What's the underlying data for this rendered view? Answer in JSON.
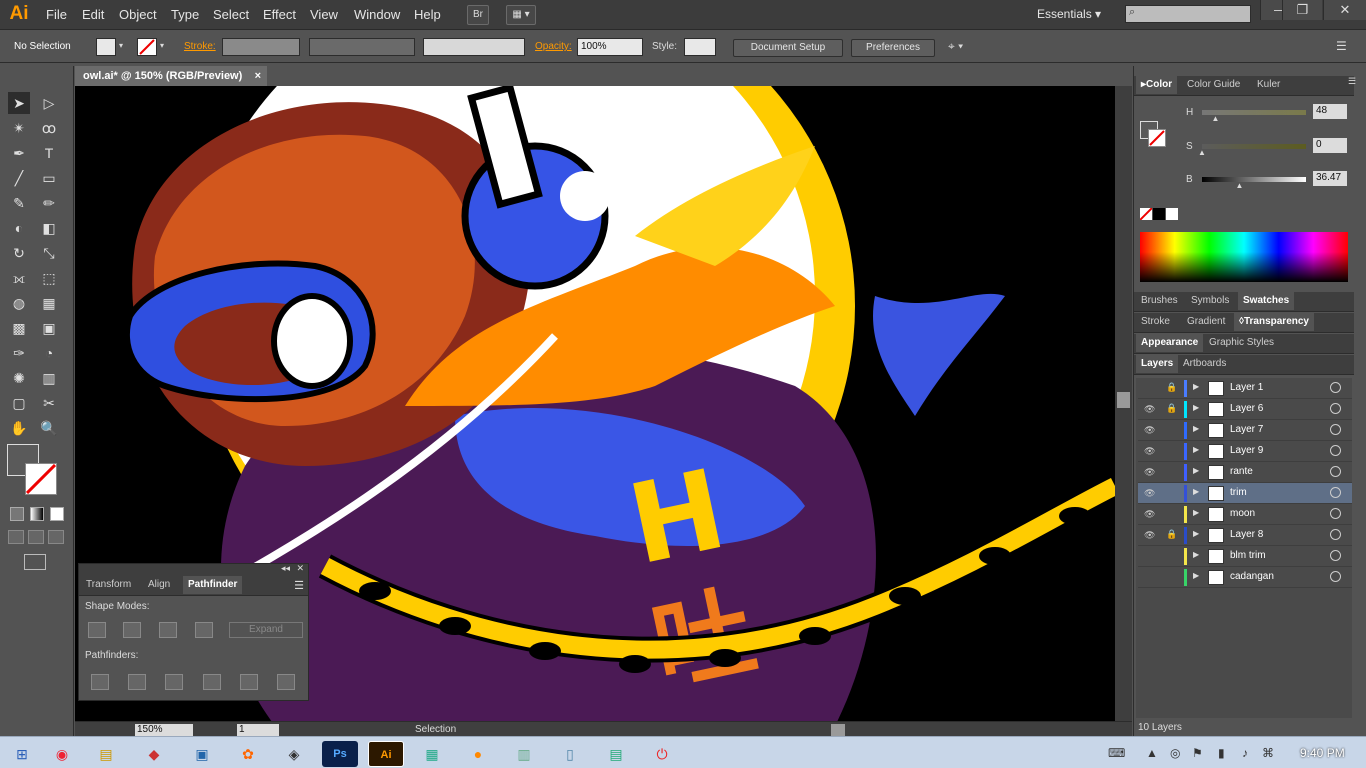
{
  "app": {
    "logo": "Ai",
    "workspace": "Essentials"
  },
  "menu": [
    "File",
    "Edit",
    "Object",
    "Type",
    "Select",
    "Effect",
    "View",
    "Window",
    "Help"
  ],
  "menu_buttons": {
    "bridge": "Br",
    "arrange": "▦"
  },
  "control": {
    "selection": "No Selection",
    "stroke_label": "Stroke:",
    "opacity_label": "Opacity:",
    "opacity_value": "100%",
    "style_label": "Style:",
    "document_setup": "Document Setup",
    "preferences": "Preferences"
  },
  "document": {
    "tab_title": "owl.ai* @ 150% (RGB/Preview)",
    "close": "×"
  },
  "status": {
    "zoom": "150%",
    "artboard": "1",
    "tool": "Selection"
  },
  "color_panel": {
    "tabs": [
      "Color",
      "Color Guide",
      "Kuler"
    ],
    "h_label": "H",
    "h_value": "48",
    "s_label": "S",
    "s_value": "0",
    "b_label": "B",
    "b_value": "36.47",
    "h_fill": 0.13,
    "s_fill": 0.0,
    "b_fill": 0.36
  },
  "panel_tabs": {
    "row1": [
      "Brushes",
      "Symbols",
      "Swatches"
    ],
    "row2": [
      "Stroke",
      "Gradient",
      "Transparency"
    ],
    "row3": [
      "Appearance",
      "Graphic Styles"
    ],
    "row4": [
      "Layers",
      "Artboards"
    ]
  },
  "layers": [
    {
      "name": "Layer 1",
      "eye": false,
      "lock": true,
      "color": "#4a7cff",
      "selected": false
    },
    {
      "name": "Layer 6",
      "eye": true,
      "lock": true,
      "color": "#00e5ff",
      "selected": false
    },
    {
      "name": "Layer 7",
      "eye": true,
      "lock": false,
      "color": "#2f6bff",
      "selected": false
    },
    {
      "name": "Layer 9",
      "eye": true,
      "lock": false,
      "color": "#3a66ff",
      "selected": false
    },
    {
      "name": "rante",
      "eye": true,
      "lock": false,
      "color": "#3f5fff",
      "selected": false
    },
    {
      "name": "trim",
      "eye": true,
      "lock": false,
      "color": "#3450d8",
      "selected": true
    },
    {
      "name": "moon",
      "eye": true,
      "lock": false,
      "color": "#f4e64a",
      "selected": false
    },
    {
      "name": "Layer 8",
      "eye": true,
      "lock": true,
      "color": "#2a4cc9",
      "selected": false
    },
    {
      "name": "blm trim",
      "eye": false,
      "lock": false,
      "color": "#f4e64a",
      "selected": false
    },
    {
      "name": "cadangan",
      "eye": false,
      "lock": false,
      "color": "#38d468",
      "selected": false
    }
  ],
  "layers_footer": "10 Layers",
  "pathfinder": {
    "tabs": [
      "Transform",
      "Align",
      "Pathfinder"
    ],
    "shape_modes": "Shape Modes:",
    "pathfinders": "Pathfinders:",
    "expand": "Expand"
  },
  "taskbar": {
    "time": "9:40 PM"
  },
  "icons": [
    "selection-tool",
    "direct-selection-tool",
    "magic-wand",
    "lasso",
    "pen",
    "type",
    "line",
    "rectangle",
    "paintbrush",
    "pencil",
    "blob-brush",
    "eraser",
    "rotate",
    "scale",
    "width",
    "free-transform",
    "shape-builder",
    "perspective-grid",
    "mesh",
    "gradient",
    "eyedropper",
    "blend",
    "symbol-sprayer",
    "column-graph",
    "artboard",
    "slice",
    "hand",
    "zoom"
  ]
}
